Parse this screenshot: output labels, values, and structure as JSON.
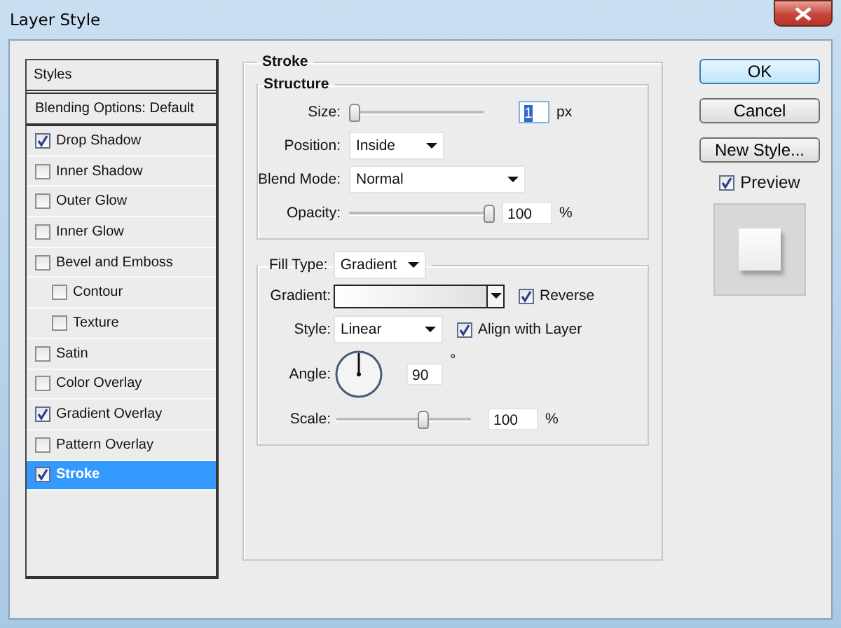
{
  "window": {
    "title": "Layer Style"
  },
  "styles_panel": {
    "header": "Styles",
    "items": [
      {
        "label": "Blending Options: Default",
        "kind": "plain",
        "selected": false
      },
      {
        "label": "Drop Shadow",
        "kind": "check",
        "checked": true,
        "selected": false
      },
      {
        "label": "Inner Shadow",
        "kind": "check",
        "checked": false,
        "selected": false
      },
      {
        "label": "Outer Glow",
        "kind": "check",
        "checked": false,
        "selected": false
      },
      {
        "label": "Inner Glow",
        "kind": "check",
        "checked": false,
        "selected": false
      },
      {
        "label": "Bevel and Emboss",
        "kind": "check",
        "checked": false,
        "selected": false,
        "children": [
          {
            "label": "Contour",
            "kind": "check",
            "checked": false,
            "selected": false
          },
          {
            "label": "Texture",
            "kind": "check",
            "checked": false,
            "selected": false
          }
        ]
      },
      {
        "label": "Satin",
        "kind": "check",
        "checked": false,
        "selected": false
      },
      {
        "label": "Color Overlay",
        "kind": "check",
        "checked": false,
        "selected": false
      },
      {
        "label": "Gradient Overlay",
        "kind": "check",
        "checked": true,
        "selected": false
      },
      {
        "label": "Pattern Overlay",
        "kind": "check",
        "checked": false,
        "selected": false
      },
      {
        "label": "Stroke",
        "kind": "check",
        "checked": true,
        "selected": true
      }
    ]
  },
  "stroke": {
    "title": "Stroke",
    "structure": {
      "title": "Structure",
      "size": {
        "label": "Size:",
        "level": 0.0,
        "value": "1",
        "value_selected": true,
        "unit": "px"
      },
      "position": {
        "label": "Position:",
        "value": "Inside"
      },
      "blend_mode": {
        "label": "Blend Mode:",
        "value": "Normal"
      },
      "opacity": {
        "label": "Opacity:",
        "level": 1.0,
        "value": "100",
        "unit": "%"
      }
    },
    "fill": {
      "label": "Fill Type:",
      "value": "Gradient",
      "gradient": {
        "label": "Gradient:"
      },
      "reverse": {
        "label": "Reverse",
        "checked": true
      },
      "style": {
        "label": "Style:",
        "value": "Linear"
      },
      "align": {
        "label": "Align with Layer",
        "checked": true
      },
      "angle": {
        "label": "Angle:",
        "value": "90",
        "unit": "°"
      },
      "scale": {
        "label": "Scale:",
        "level": 0.66,
        "value": "100",
        "unit": "%"
      }
    }
  },
  "buttons": [
    {
      "label": "OK",
      "default": true
    },
    {
      "label": "Cancel",
      "default": false
    },
    {
      "label": "New Style...",
      "default": false
    }
  ],
  "preview": {
    "label": "Preview",
    "checked": true
  }
}
